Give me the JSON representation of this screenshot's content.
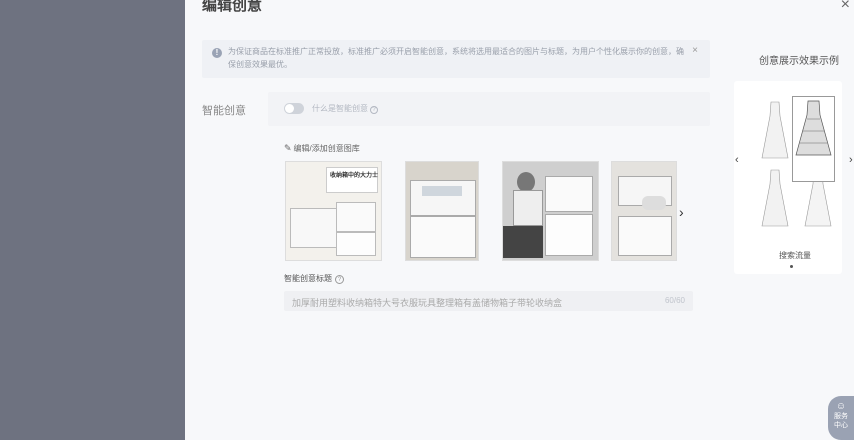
{
  "drawer": {
    "title": "编辑创意",
    "close_glyph": "×"
  },
  "notice": {
    "text": "为保证商品在标准推广正常投放，标准推广必须开启智能创意，系统将选用最适合的图片与标题，为用户个性化展示你的创意，确保创意效果最优。",
    "close_glyph": "×"
  },
  "smart_creative": {
    "label": "智能创意",
    "toggle_on": false,
    "what_is": "什么是智能创意"
  },
  "gallery": {
    "edit_link": "编辑/添加创意图库",
    "images": [
      {
        "alt": "storage-box-product-1",
        "overlay_text": "收纳箱中的大力士"
      },
      {
        "alt": "storage-box-product-2",
        "overlay_text": ""
      },
      {
        "alt": "storage-box-product-3",
        "overlay_text": ""
      },
      {
        "alt": "storage-box-product-4",
        "overlay_text": ""
      }
    ]
  },
  "creative_title": {
    "label": "智能创意标题",
    "value": "加厚耐用塑料收纳箱特大号衣服玩具整理箱有盖储物箱子带轮收纳盒",
    "count": "60/60"
  },
  "preview": {
    "heading": "创意展示效果示例",
    "caption": "搜索流量"
  },
  "support": {
    "label_line1": "服务",
    "label_line2": "中心"
  },
  "colors": {
    "overlay": "#6e7280",
    "drawer_bg": "#f7f8fa",
    "notice_bg": "#eff1f5"
  }
}
